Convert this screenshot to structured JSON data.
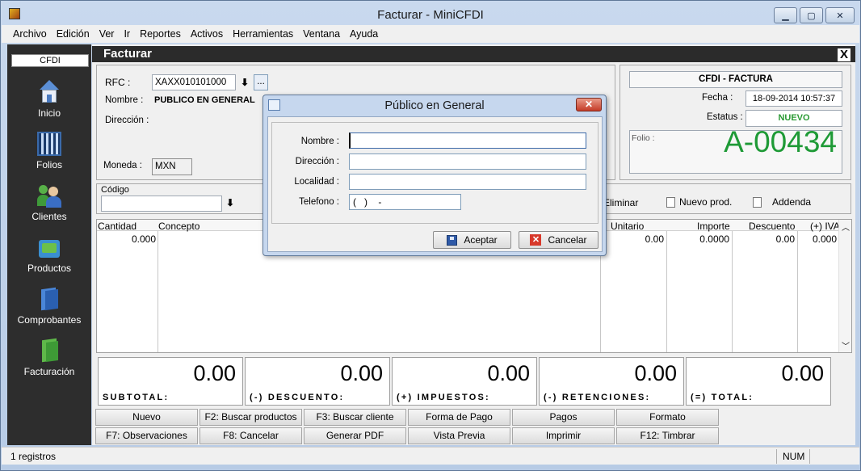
{
  "window": {
    "title": "Facturar - MiniCFDI",
    "minimize": "▁",
    "maximize": "▢",
    "close": "✕"
  },
  "menu": [
    "Archivo",
    "Edición",
    "Ver",
    "Ir",
    "Reportes",
    "Activos",
    "Herramientas",
    "Ventana",
    "Ayuda"
  ],
  "sidebar": {
    "header": "CFDI",
    "items": [
      {
        "label": "Inicio",
        "icon": "home-icon"
      },
      {
        "label": "Folios",
        "icon": "qr-code-icon"
      },
      {
        "label": "Clientes",
        "icon": "users-icon"
      },
      {
        "label": "Productos",
        "icon": "box-icon"
      },
      {
        "label": "Comprobantes",
        "icon": "documents-icon"
      },
      {
        "label": "Facturación",
        "icon": "invoice-icon"
      }
    ]
  },
  "form": {
    "title": "Facturar",
    "close": "X",
    "rfc_label": "RFC :",
    "rfc_value": "XAXX010101000",
    "rfc_browse": "...",
    "nombre_label": "Nombre :",
    "nombre_value": "PUBLICO EN GENERAL",
    "direccion_label": "Dirección :",
    "moneda_label": "Moneda :",
    "moneda_value": "MXN",
    "cfdi_type": "CFDI - FACTURA",
    "fecha_label": "Fecha :",
    "fecha_value": "18-09-2014 10:57:37",
    "estatus_label": "Estatus :",
    "estatus_value": "NUEVO",
    "folio_label": "Folio :",
    "folio_value": "A-00434",
    "codigo_label": "Código",
    "toolbar": {
      "eliminar": "Eliminar",
      "nuevo_prod": "Nuevo prod.",
      "addenda": "Addenda"
    }
  },
  "grid": {
    "columns": [
      "Cantidad",
      "Concepto",
      "Unitario",
      "Importe",
      "Descuento",
      "(+) IVA"
    ],
    "row": {
      "cantidad": "0.000",
      "unitario": "0.00",
      "importe": "0.0000",
      "descuento": "0.00",
      "iva": "0.000"
    }
  },
  "totals": [
    {
      "label": "SUBTOTAL:",
      "value": "0.00"
    },
    {
      "label": "(-) DESCUENTO:",
      "value": "0.00"
    },
    {
      "label": "(+) IMPUESTOS:",
      "value": "0.00"
    },
    {
      "label": "(-) RETENCIONES:",
      "value": "0.00"
    },
    {
      "label": "(=) TOTAL:",
      "value": "0.00"
    }
  ],
  "buttons_row1": [
    "Nuevo",
    "F2: Buscar productos",
    "F3: Buscar cliente",
    "Forma de Pago",
    "Pagos",
    "Formato"
  ],
  "buttons_row2": [
    "F7: Observaciones",
    "F8: Cancelar",
    "Generar PDF",
    "Vista Previa",
    "Imprimir",
    "F12:  Timbrar"
  ],
  "status": {
    "records": "1 registros",
    "num": "NUM"
  },
  "dialog": {
    "title": "Público en General",
    "close": "✕",
    "nombre_label": "Nombre :",
    "nombre_value": "",
    "direccion_label": "Dirección :",
    "direccion_value": "",
    "localidad_label": "Localidad :",
    "localidad_value": "",
    "telefono_label": "Telefono :",
    "telefono_value": "(   )    -",
    "accept": "Aceptar",
    "cancel": "Cancelar"
  },
  "colors": {
    "folio": "#1e9a36",
    "estatus": "#2a9a34",
    "sidebar_bg": "#2d2d2d",
    "form_title_bg": "#2b2b2b"
  }
}
